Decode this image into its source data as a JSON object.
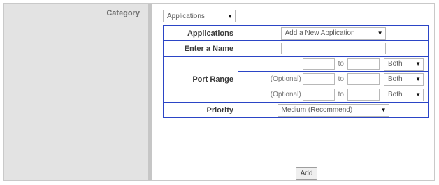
{
  "category": {
    "label": "Category",
    "selected": "Applications"
  },
  "applications": {
    "label": "Applications",
    "selected": "Add a New Application"
  },
  "name": {
    "label": "Enter a Name",
    "value": ""
  },
  "port_range": {
    "label": "Port Range",
    "rows": [
      {
        "optional": "",
        "from": "",
        "to_label": "to",
        "to": "",
        "protocol": "Both"
      },
      {
        "optional": "(Optional)",
        "from": "",
        "to_label": "to",
        "to": "",
        "protocol": "Both"
      },
      {
        "optional": "(Optional)",
        "from": "",
        "to_label": "to",
        "to": "",
        "protocol": "Both"
      }
    ]
  },
  "priority": {
    "label": "Priority",
    "selected": "Medium (Recommend)"
  },
  "add_button": {
    "label": "Add"
  },
  "colors": {
    "table_border": "#2b45c6",
    "sidebar": "#e3e3e3"
  }
}
